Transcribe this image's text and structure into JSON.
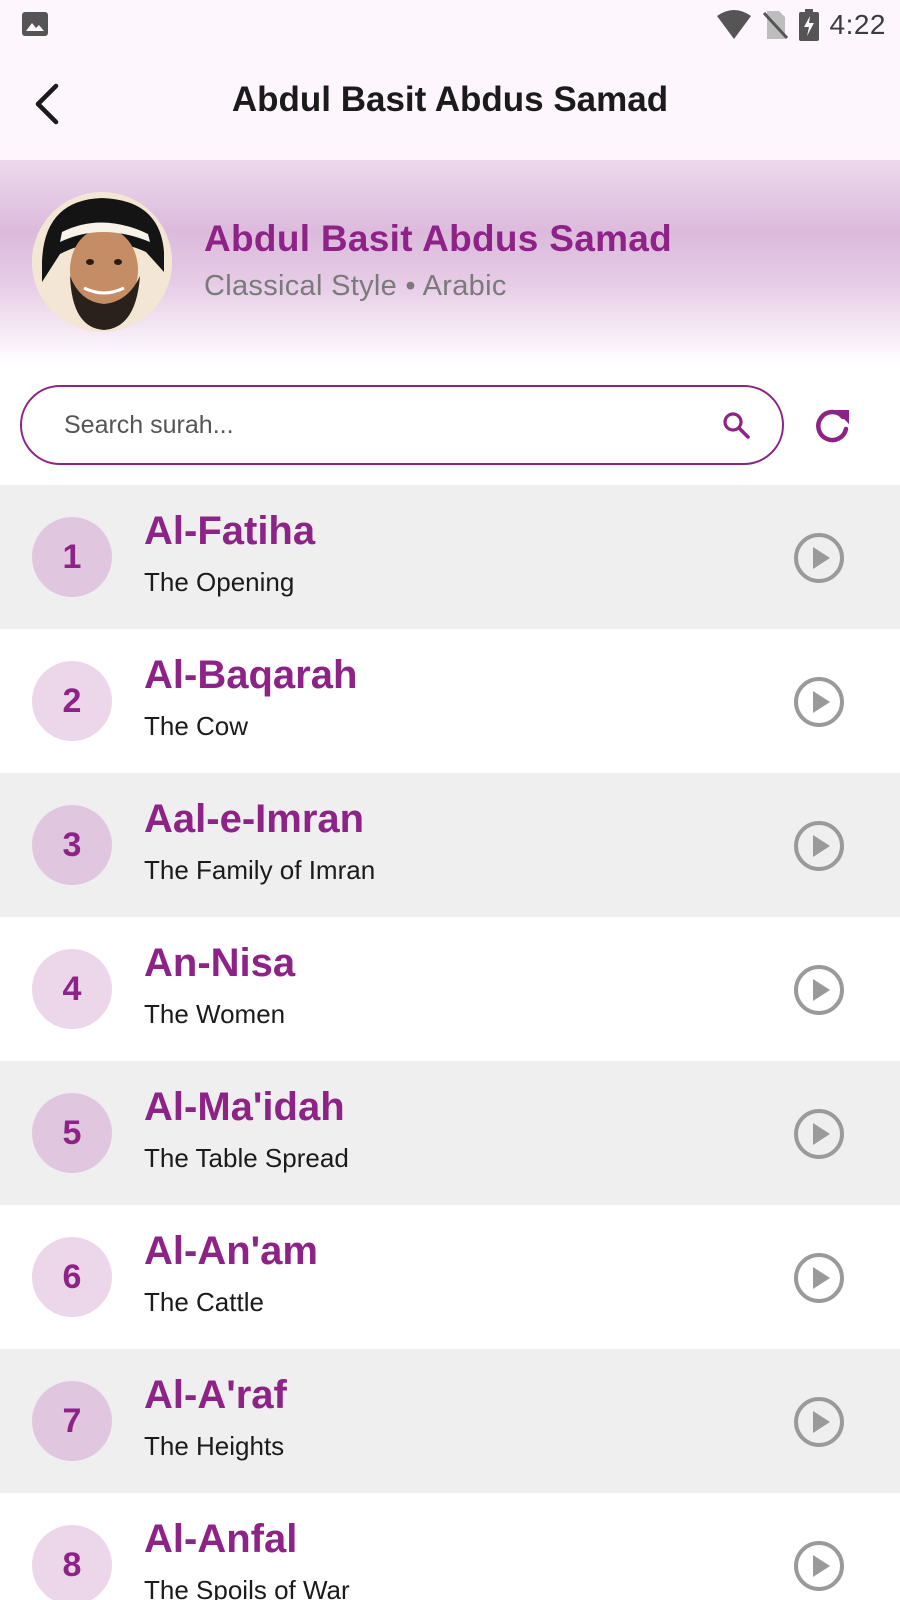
{
  "status_bar": {
    "time": "4:22",
    "icons": [
      "image-icon",
      "wifi-icon",
      "no-sim-icon",
      "battery-charging-icon"
    ]
  },
  "app_bar": {
    "title": "Abdul Basit Abdus Samad",
    "back_icon": "chevron-left-icon"
  },
  "reciter": {
    "name": "Abdul Basit Abdus Samad",
    "meta": "Classical Style • Arabic",
    "avatar_icon": "reciter-avatar"
  },
  "search": {
    "placeholder": "Search surah...",
    "value": "",
    "search_icon": "search-icon",
    "refresh_icon": "refresh-icon"
  },
  "colors": {
    "accent": "#8e2387",
    "row_alt": "#efefef",
    "header_band": "#dcbadc",
    "play_icon": "#9a9a9a"
  },
  "surahs": [
    {
      "number": "1",
      "name": "Al-Fatiha",
      "meaning": "The Opening"
    },
    {
      "number": "2",
      "name": "Al-Baqarah",
      "meaning": "The Cow"
    },
    {
      "number": "3",
      "name": "Aal-e-Imran",
      "meaning": "The Family of Imran"
    },
    {
      "number": "4",
      "name": "An-Nisa",
      "meaning": "The Women"
    },
    {
      "number": "5",
      "name": "Al-Ma'idah",
      "meaning": "The Table Spread"
    },
    {
      "number": "6",
      "name": "Al-An'am",
      "meaning": "The Cattle"
    },
    {
      "number": "7",
      "name": "Al-A'raf",
      "meaning": "The Heights"
    },
    {
      "number": "8",
      "name": "Al-Anfal",
      "meaning": "The Spoils of War"
    }
  ]
}
